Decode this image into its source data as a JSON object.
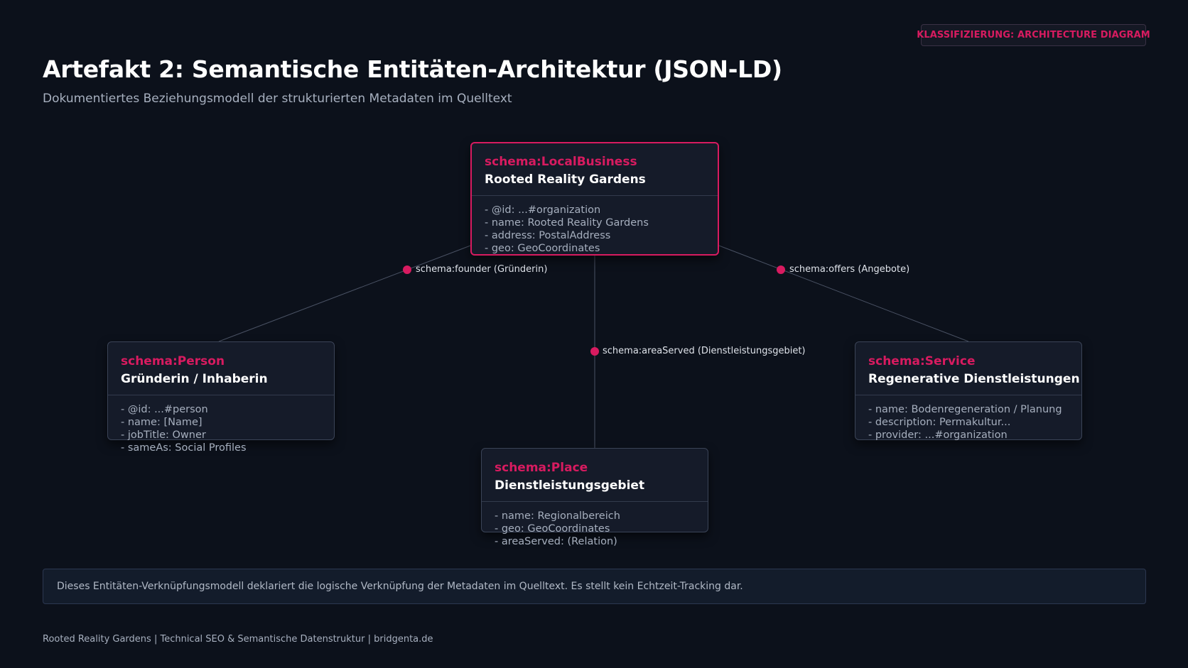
{
  "badge": "KLASSIFIZIERUNG: ARCHITECTURE DIAGRAM",
  "title": "Artefakt 2: Semantische Entitäten-Architektur (JSON-LD)",
  "subtitle": "Dokumentiertes Beziehungsmodell der strukturierten Metadaten im Quelltext",
  "accent_color": "#d81b60",
  "nodes": {
    "business": {
      "type": "schema:LocalBusiness",
      "name": "Rooted Reality Gardens",
      "props": [
        "- @id: ...#organization",
        "- name: Rooted Reality Gardens",
        "- address: PostalAddress",
        "- geo: GeoCoordinates"
      ]
    },
    "person": {
      "type": "schema:Person",
      "name": "Gründerin / Inhaberin",
      "props": [
        "- @id: ...#person",
        "- name: [Name]",
        "- jobTitle: Owner",
        "- sameAs: Social Profiles"
      ]
    },
    "service": {
      "type": "schema:Service",
      "name": "Regenerative Dienstleistungen",
      "props": [
        "- name: Bodenregeneration / Planung",
        "- description: Permakultur...",
        "- provider: ...#organization"
      ]
    },
    "place": {
      "type": "schema:Place",
      "name": "Dienstleistungsgebiet",
      "props": [
        "- name: Regionalbereich",
        "- geo: GeoCoordinates",
        "- areaServed: (Relation)"
      ]
    }
  },
  "edges": {
    "founder": "schema:founder (Gründerin)",
    "offers": "schema:offers (Angebote)",
    "area_served": "schema:areaServed (Dienstleistungsgebiet)"
  },
  "note": "Dieses Entitäten-Verknüpfungsmodell deklariert die logische Verknüpfung der Metadaten im Quelltext. Es stellt kein Echtzeit-Tracking dar.",
  "footer": "Rooted Reality Gardens | Technical SEO & Semantische Datenstruktur | bridgenta.de"
}
